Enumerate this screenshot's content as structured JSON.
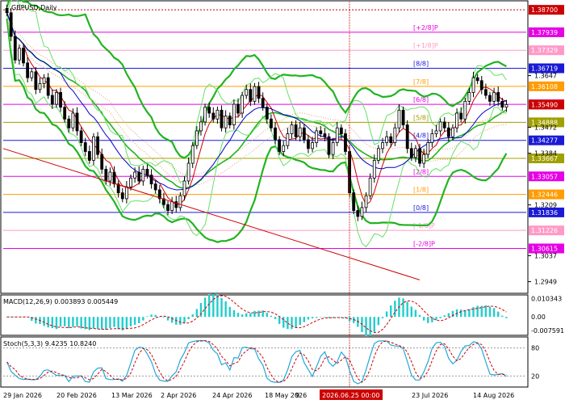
{
  "chart_data": {
    "type": "candlestick",
    "symbol_label": "GBPUSD,Daily",
    "price_axis": {
      "ylim": [
        1.2915,
        1.3895
      ],
      "ticks": [
        "1.3870",
        "1.3793",
        "1.3732",
        "1.3647",
        "1.3610",
        "1.3549",
        "1.3472",
        "1.3427",
        "1.3384",
        "1.3305",
        "1.3244",
        "1.3209",
        "1.3183",
        "1.3122",
        "1.3061",
        "1.3037",
        "1.2949"
      ]
    },
    "x_labels": [
      "29 Jan 2026",
      "20 Feb 2026",
      "13 Mar 2026",
      "2 Apr 2026",
      "24 Apr 2026",
      "18 May 2026",
      "9",
      "2026.06.25 00:00",
      "23 Jul 2026",
      "14 Aug 2026"
    ],
    "cursor_time": "2026.06.25 00:00",
    "murrey_levels": [
      {
        "label": "[+2/8]P",
        "price": 1.37939,
        "price_label": "1.37939",
        "color": "#e600e6"
      },
      {
        "label": "[+1/8]P",
        "price": 1.37329,
        "price_label": "1.37329",
        "color": "#ff9ac8"
      },
      {
        "label": "[8/8]",
        "price": 1.36719,
        "price_label": "1.36719",
        "color": "#1a1ad6"
      },
      {
        "label": "[7/8]",
        "price": 1.36108,
        "price_label": "1.36108",
        "color": "#ff9c00"
      },
      {
        "label": "[6/8]",
        "price": 1.35498,
        "price_label": "1.35498",
        "color": "#e600e6"
      },
      {
        "label": "[5/8]",
        "price": 1.34888,
        "price_label": "1.34888",
        "color": "#a0a000"
      },
      {
        "label": "[4/8]",
        "price": 1.34277,
        "price_label": "1.34277",
        "color": "#1a1ad6"
      },
      {
        "label": "[3/8]",
        "price": 1.33667,
        "price_label": "1.33667",
        "color": "#a0a000"
      },
      {
        "label": "[2/8]",
        "price": 1.33057,
        "price_label": "1.33057",
        "color": "#e600e6"
      },
      {
        "label": "[1/8]",
        "price": 1.32446,
        "price_label": "1.32446",
        "color": "#ff9c00"
      },
      {
        "label": "[0/8]",
        "price": 1.31836,
        "price_label": "1.31836",
        "color": "#1a1ad6"
      },
      {
        "label": "[-1/8]P",
        "price": 1.31226,
        "price_label": "1.31226",
        "color": "#ff9ac8"
      },
      {
        "label": "[-2/8]P",
        "price": 1.30615,
        "price_label": "1.30615",
        "color": "#e600e6"
      }
    ],
    "top_level": {
      "price": 1.387,
      "price_label": "1.38700"
    },
    "current_price": {
      "price": 1.3549,
      "price_label": "1.35490"
    },
    "candles_close": [
      1.386,
      1.378,
      1.37,
      1.374,
      1.369,
      1.364,
      1.366,
      1.36,
      1.362,
      1.364,
      1.358,
      1.355,
      1.359,
      1.354,
      1.35,
      1.347,
      1.352,
      1.346,
      1.342,
      1.339,
      1.336,
      1.344,
      1.338,
      1.333,
      1.329,
      1.332,
      1.328,
      1.325,
      1.323,
      1.327,
      1.33,
      1.332,
      1.329,
      1.333,
      1.331,
      1.328,
      1.326,
      1.323,
      1.321,
      1.319,
      1.322,
      1.32,
      1.324,
      1.329,
      1.335,
      1.341,
      1.346,
      1.349,
      1.354,
      1.352,
      1.35,
      1.353,
      1.347,
      1.351,
      1.348,
      1.355,
      1.352,
      1.358,
      1.36,
      1.356,
      1.361,
      1.357,
      1.354,
      1.35,
      1.347,
      1.343,
      1.339,
      1.341,
      1.345,
      1.348,
      1.344,
      1.347,
      1.343,
      1.34,
      1.342,
      1.346,
      1.345,
      1.344,
      1.338,
      1.342,
      1.347,
      1.345,
      1.339,
      1.325,
      1.319,
      1.317,
      1.32,
      1.324,
      1.33,
      1.336,
      1.34,
      1.342,
      1.344,
      1.342,
      1.347,
      1.353,
      1.348,
      1.34,
      1.337,
      1.34,
      1.335,
      1.338,
      1.342,
      1.345,
      1.346,
      1.349,
      1.347,
      1.344,
      1.347,
      1.352,
      1.35,
      1.356,
      1.359,
      1.364,
      1.363,
      1.36,
      1.358,
      1.356,
      1.359,
      1.356,
      1.354,
      1.3549
    ],
    "indicators": [
      {
        "name": "MACD",
        "label": "MACD(12,26,9) 0.003893 0.005449",
        "ticks": [
          "0.010343",
          "0.00",
          "-0.007591"
        ],
        "ylim": [
          -0.0095,
          0.0115
        ]
      },
      {
        "name": "Stoch",
        "label": "Stoch(5,3,3) 9.4235 10.8240",
        "ticks": [
          "80",
          "20"
        ],
        "ylim": [
          0,
          100
        ]
      }
    ],
    "colors": {
      "bollinger": "#22b322",
      "ma_fast": "#cc0000",
      "ma_slow": "#0000cc",
      "ichimoku": "#e0a070",
      "trendline": "#cc0000",
      "macd_hist": "#22cccc",
      "macd_signal": "#cc0000",
      "stoch_main": "#22a8d8",
      "stoch_signal": "#cc0000",
      "price_box": "#cc0000"
    }
  }
}
